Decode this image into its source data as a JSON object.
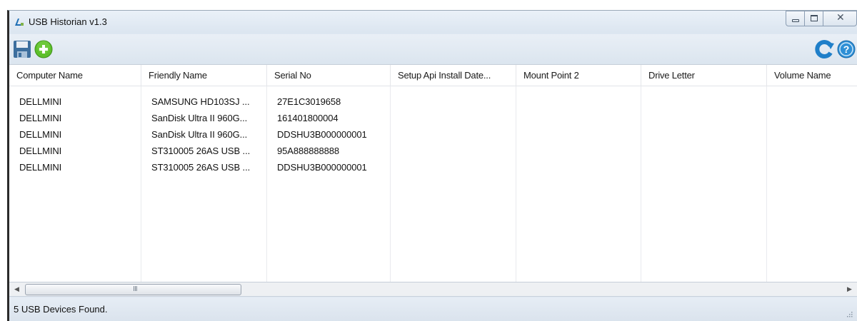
{
  "window": {
    "title": "USB Historian v1.3",
    "close_glyph": "✕"
  },
  "toolbar": {
    "left_icons": [
      "save-icon",
      "add-icon"
    ],
    "right_icons": [
      "refresh-icon",
      "help-icon"
    ]
  },
  "grid": {
    "columns": [
      "Computer Name",
      "Friendly Name",
      "Serial No",
      "Setup Api Install Date...",
      "Mount Point 2",
      "Drive Letter",
      "Volume Name"
    ],
    "rows": [
      [
        "DELLMINI",
        "SAMSUNG HD103SJ ...",
        "27E1C3019658"
      ],
      [
        "DELLMINI",
        "SanDisk Ultra II 960G...",
        "161401800004"
      ],
      [
        "DELLMINI",
        "SanDisk Ultra II 960G...",
        "DDSHU3B000000001"
      ],
      [
        "DELLMINI",
        "ST310005 26AS USB ...",
        "95A888888888"
      ],
      [
        "DELLMINI",
        "ST310005 26AS USB ...",
        "DDSHU3B000000001"
      ]
    ]
  },
  "scrollbar": {
    "left_arrow": "◀",
    "right_arrow": "▶",
    "grip": "III"
  },
  "status": {
    "text": "5 USB Devices Found."
  },
  "colors": {
    "accent_green": "#5cbf2a",
    "accent_blue": "#1f7fc9",
    "window_bg": "#dfe8f2"
  }
}
